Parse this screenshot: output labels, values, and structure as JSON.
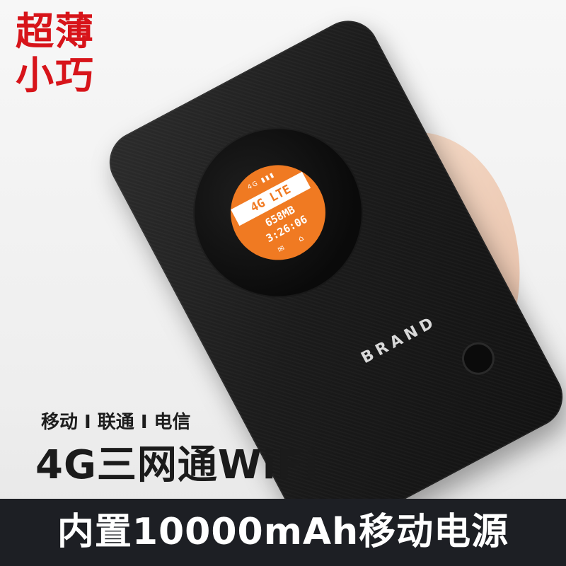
{
  "badge": {
    "line1": "超薄",
    "line2": "小巧"
  },
  "device": {
    "screen": {
      "status": "4G ▮▮▮",
      "network": "4G LTE",
      "data_usage": "658MB",
      "time": "3:26:06",
      "icons": "✉ ⌂"
    },
    "brand": "BRAND"
  },
  "marketing": {
    "carriers": "移动 I 联通 I 电信",
    "headline": "4G三网通WiFi",
    "battery_caption": "内置10000mAh移动电源"
  },
  "colors": {
    "badge_red": "#d7141a",
    "screen_orange": "#f07a22",
    "device_black": "#1b1b1b",
    "bar_dark": "#1d1f24"
  }
}
